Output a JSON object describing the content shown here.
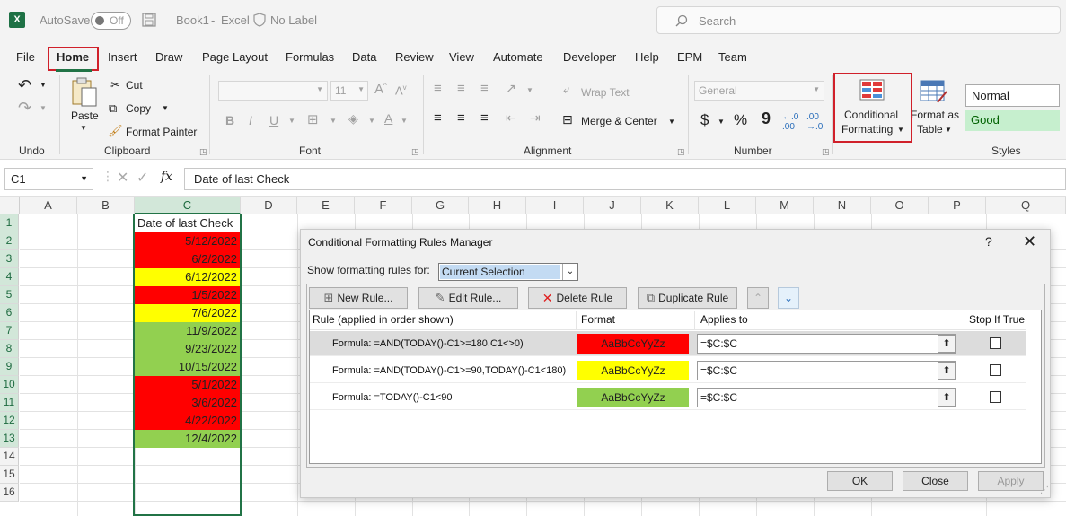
{
  "titlebar": {
    "app_icon": "X",
    "autosave_label": "AutoSave",
    "autosave_state": "Off",
    "file_name": "Book1",
    "app_name": "Excel",
    "separator": "-",
    "label_status": "No Label",
    "search_placeholder": "Search"
  },
  "tabs": [
    "File",
    "Home",
    "Insert",
    "Draw",
    "Page Layout",
    "Formulas",
    "Data",
    "Review",
    "View",
    "Automate",
    "Developer",
    "Help",
    "EPM",
    "Team"
  ],
  "ribbon": {
    "undo_group": "Undo",
    "clipboard": {
      "paste": "Paste",
      "cut": "Cut",
      "copy": "Copy",
      "format_painter": "Format Painter",
      "group": "Clipboard"
    },
    "font": {
      "size": "11",
      "group": "Font"
    },
    "alignment": {
      "wrap_text": "Wrap Text",
      "merge_center": "Merge & Center",
      "group": "Alignment"
    },
    "number": {
      "format": "General",
      "currency": "$",
      "percent": "%",
      "comma": "9",
      "group": "Number"
    },
    "conditional_formatting": {
      "line1": "Conditional",
      "line2": "Formatting"
    },
    "format_as_table": {
      "line1": "Format as",
      "line2": "Table"
    },
    "styles": {
      "normal": "Normal",
      "good": "Good",
      "group": "Styles"
    }
  },
  "formula_bar": {
    "name_box": "C1",
    "fx": "fx",
    "content": "Date of last Check"
  },
  "sheet": {
    "columns": [
      "A",
      "B",
      "C",
      "D",
      "E",
      "F",
      "G",
      "H",
      "I",
      "J",
      "K",
      "L",
      "M",
      "N",
      "O",
      "P",
      "Q"
    ],
    "rows": [
      "1",
      "2",
      "3",
      "4",
      "5",
      "6",
      "7",
      "8",
      "9",
      "10",
      "11",
      "12",
      "13",
      "14",
      "15",
      "16"
    ],
    "header_cell": "Date of last Check",
    "dates": [
      {
        "value": "5/12/2022",
        "color": "#ff0000"
      },
      {
        "value": "6/2/2022",
        "color": "#ff0000"
      },
      {
        "value": "6/12/2022",
        "color": "#ffff00"
      },
      {
        "value": "1/5/2022",
        "color": "#ff0000"
      },
      {
        "value": "7/6/2022",
        "color": "#ffff00"
      },
      {
        "value": "11/9/2022",
        "color": "#92d050"
      },
      {
        "value": "9/23/2022",
        "color": "#92d050"
      },
      {
        "value": "10/15/2022",
        "color": "#92d050"
      },
      {
        "value": "5/1/2022",
        "color": "#ff0000"
      },
      {
        "value": "3/6/2022",
        "color": "#ff0000"
      },
      {
        "value": "4/22/2022",
        "color": "#ff0000"
      },
      {
        "value": "12/4/2022",
        "color": "#92d050"
      }
    ]
  },
  "dialog": {
    "title": "Conditional Formatting Rules Manager",
    "help": "?",
    "close": "✕",
    "show_rules_for": "Show formatting rules for:",
    "scope": "Current Selection",
    "buttons": {
      "new_rule": "New Rule...",
      "edit_rule": "Edit Rule...",
      "delete_rule": "Delete Rule",
      "duplicate_rule": "Duplicate Rule"
    },
    "columns": {
      "rule": "Rule (applied in order shown)",
      "format": "Format",
      "applies_to": "Applies to",
      "stop_if_true": "Stop If True"
    },
    "rules": [
      {
        "formula": "Formula: =AND(TODAY()-C1>=180,C1<>0)",
        "preview": "AaBbCcYyZz",
        "fill": "#ff0000",
        "applies": "=$C:$C",
        "stop": false
      },
      {
        "formula": "Formula: =AND(TODAY()-C1>=90,TODAY()-C1<180)",
        "preview": "AaBbCcYyZz",
        "fill": "#ffff00",
        "applies": "=$C:$C",
        "stop": false
      },
      {
        "formula": "Formula: =TODAY()-C1<90",
        "preview": "AaBbCcYyZz",
        "fill": "#92d050",
        "applies": "=$C:$C",
        "stop": false
      }
    ],
    "ok": "OK",
    "close_btn": "Close",
    "apply": "Apply"
  }
}
